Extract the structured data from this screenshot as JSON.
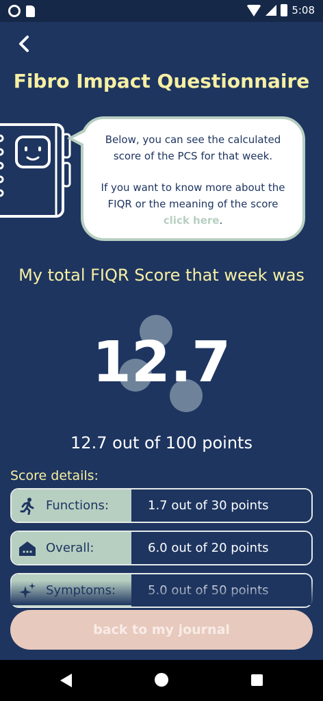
{
  "status_bar": {
    "time": "5:08",
    "icons": [
      "notification-circle-icon",
      "sd-card-icon",
      "wifi-icon",
      "cell-signal-icon",
      "battery-icon"
    ]
  },
  "header": {
    "back_icon": "chevron-left-icon",
    "title": "Fibro Impact Questionnaire"
  },
  "info_bubble": {
    "line1": "Below, you can see the calculated score of the PCS for that week.",
    "line2": "If you want to know more about the FIQR or the meaning of the score",
    "link": "click here",
    "suffix": "."
  },
  "score": {
    "heading": "My total FIQR Score that week was",
    "value": "12.7",
    "summary": "12.7 out of 100 points"
  },
  "details": {
    "label": "Score details:",
    "rows": [
      {
        "name": "Functions:",
        "value": "1.7 out of 30 points",
        "icon": "running-person-icon"
      },
      {
        "name": "Overall:",
        "value": "6.0 out of 20 points",
        "icon": "house-icon"
      },
      {
        "name": "Symptoms:",
        "value": "5.0 out of 50 points",
        "icon": "sparkles-icon"
      }
    ]
  },
  "footer": {
    "button_label": "back to my journal"
  },
  "colors": {
    "background": "#1e3560",
    "title_yellow": "#f7f0a3",
    "sage": "#b7cfc1",
    "button_pink": "#e8c9bd"
  }
}
